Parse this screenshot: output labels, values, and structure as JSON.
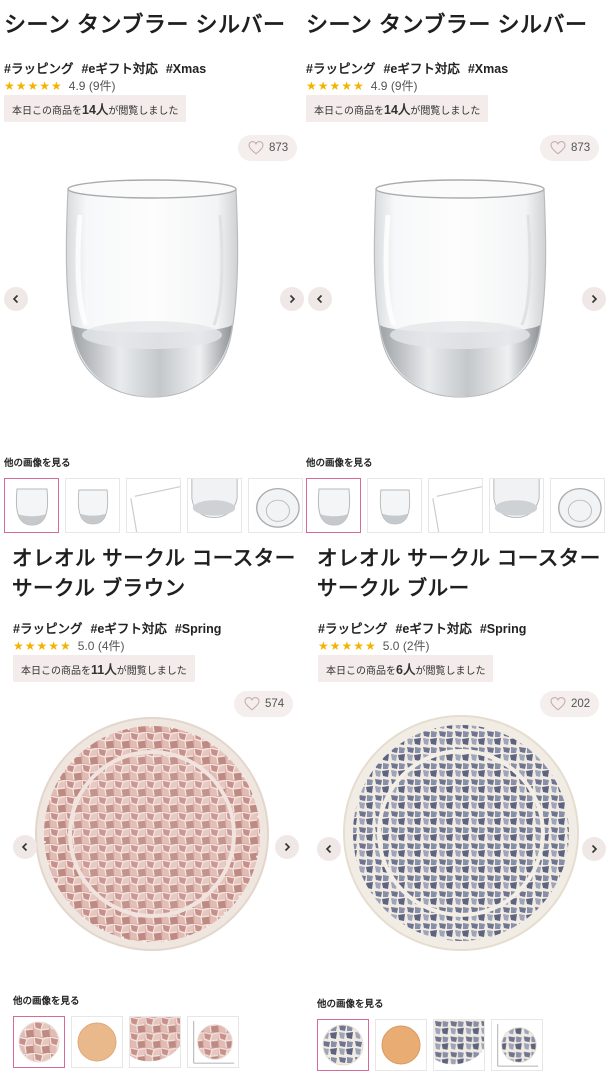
{
  "products": [
    {
      "title_line1": "シーン タンブラー シルバー",
      "title_line2": "",
      "tags": [
        "#ラッピング",
        "#eギフト対応",
        "#Xmas"
      ],
      "stars": "★★★★★",
      "rating": "4.9",
      "reviews": "(9件)",
      "viewed_prefix": "本日この商品を",
      "viewed_count": "14人",
      "viewed_suffix": "が閲覧しました",
      "favorites": "873",
      "more_images": "他の画像を見る"
    },
    {
      "title_line1": "シーン タンブラー シルバー",
      "title_line2": "",
      "tags": [
        "#ラッピング",
        "#eギフト対応",
        "#Xmas"
      ],
      "stars": "★★★★★",
      "rating": "4.9",
      "reviews": "(9件)",
      "viewed_prefix": "本日この商品を",
      "viewed_count": "14人",
      "viewed_suffix": "が閲覧しました",
      "favorites": "873",
      "more_images": "他の画像を見る"
    },
    {
      "title_line1": "オレオル サークル コースター",
      "title_line2": "サークル ブラウン",
      "tags": [
        "#ラッピング",
        "#eギフト対応",
        "#Spring"
      ],
      "stars": "★★★★★",
      "rating": "5.0",
      "reviews": "(4件)",
      "viewed_prefix": "本日この商品を",
      "viewed_count": "11人",
      "viewed_suffix": "が閲覧しました",
      "favorites": "574",
      "more_images": "他の画像を見る"
    },
    {
      "title_line1": "オレオル サークル コースター",
      "title_line2": "サークル ブルー",
      "tags": [
        "#ラッピング",
        "#eギフト対応",
        "#Spring"
      ],
      "stars": "★★★★★",
      "rating": "5.0",
      "reviews": "(2件)",
      "viewed_prefix": "本日この商品を",
      "viewed_count": "6人",
      "viewed_suffix": "が閲覧しました",
      "favorites": "202",
      "more_images": "他の画像を見る"
    }
  ],
  "colors": {
    "star": "#f2b400",
    "badge_bg": "#f3eceb",
    "active_thumb_border": "#d86a9b"
  },
  "icons": {
    "favorite": "heart-icon",
    "prev": "chevron-left-icon",
    "next": "chevron-right-icon"
  }
}
